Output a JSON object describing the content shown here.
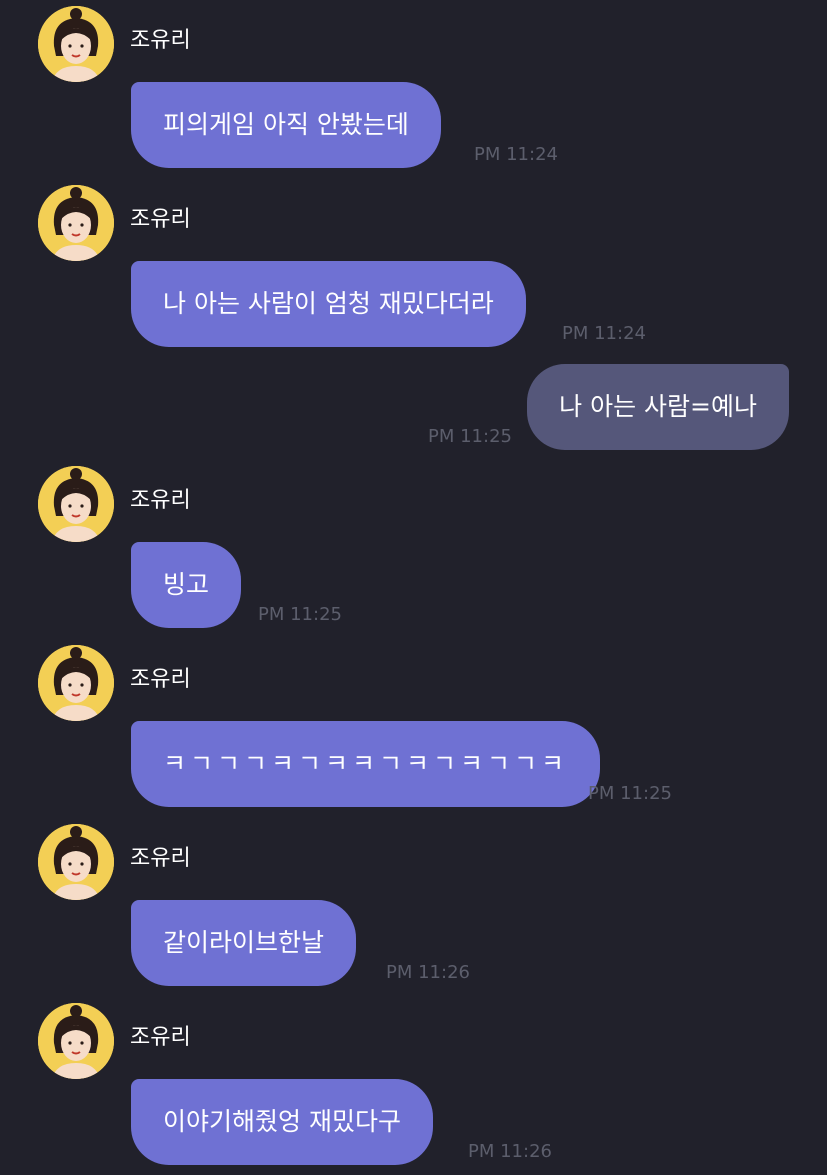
{
  "messages": [
    {
      "sender": "조유리",
      "text": "피의게임 아직 안봤는데",
      "time": "PM 11:24"
    },
    {
      "sender": "조유리",
      "text": "나 아는 사람이 엄청 재밌다더라",
      "time": "PM 11:24"
    },
    {
      "sender": "",
      "text": "나 아는 사람=예나",
      "time": "PM 11:25"
    },
    {
      "sender": "조유리",
      "text": "빙고",
      "time": "PM 11:25"
    },
    {
      "sender": "조유리",
      "text": "ㅋㄱㄱㄱㅋㄱㅋㅋㄱㅋㄱㅋㄱㄱㅋ",
      "time": "PM 11:25"
    },
    {
      "sender": "조유리",
      "text": "같이라이브한날",
      "time": "PM 11:26"
    },
    {
      "sender": "조유리",
      "text": "이야기해줬엉 재밌다구",
      "time": "PM 11:26"
    }
  ],
  "colors": {
    "background": "#21212b",
    "incoming_bubble": "#6f71d3",
    "outgoing_bubble": "#55577a",
    "timestamp": "#5c5e6c",
    "avatar_background": "#f3cf55"
  }
}
